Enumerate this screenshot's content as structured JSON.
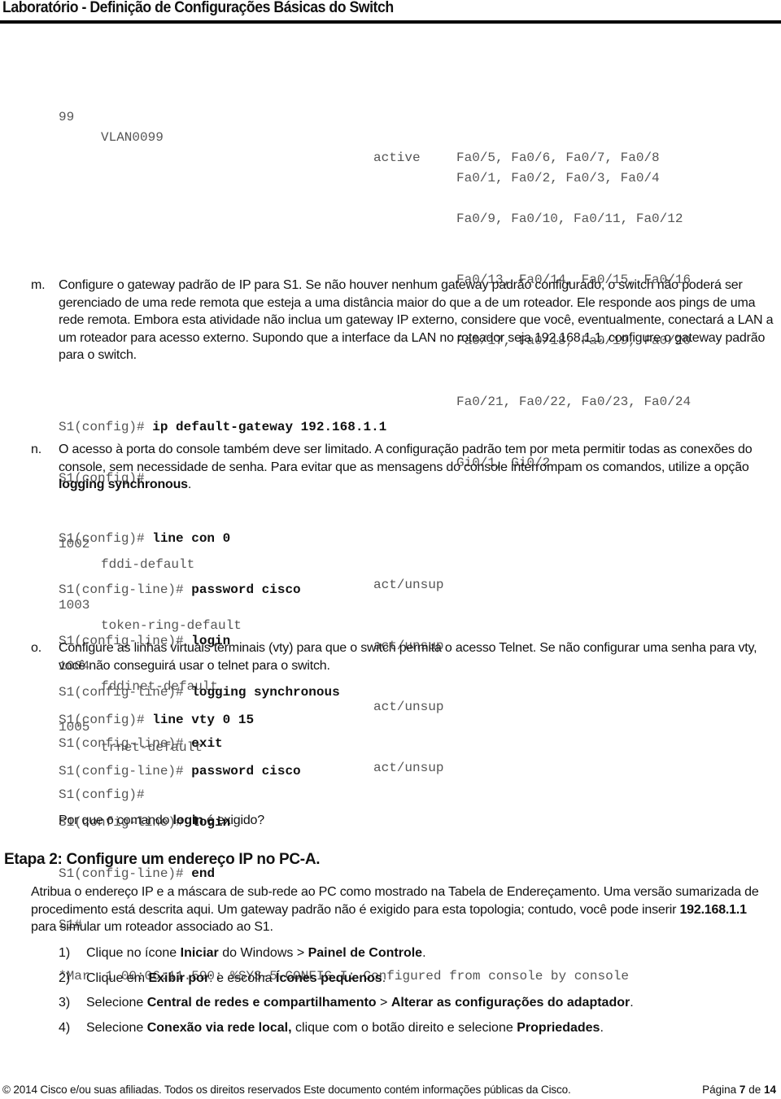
{
  "header": {
    "title": "Laboratório - Definição de Configurações Básicas do Switch"
  },
  "vlan_output": {
    "rows": [
      {
        "id": "99",
        "name": "VLAN0099",
        "status": "active",
        "ports": [
          "Fa0/1, Fa0/2, Fa0/3, Fa0/4",
          "Fa0/5, Fa0/6, Fa0/7, Fa0/8",
          "Fa0/9, Fa0/10, Fa0/11, Fa0/12",
          "Fa0/13, Fa0/14, Fa0/15, Fa0/16",
          "Fa0/17, Fa0/18, Fa0/19, Fa0/20",
          "Fa0/21, Fa0/22, Fa0/23, Fa0/24",
          "Gi0/1, Gi0/2"
        ]
      },
      {
        "id": "1002",
        "name": "fddi-default",
        "status": "act/unsup"
      },
      {
        "id": "1003",
        "name": "token-ring-default",
        "status": "act/unsup"
      },
      {
        "id": "1004",
        "name": "fddinet-default",
        "status": "act/unsup"
      },
      {
        "id": "1005",
        "name": "trnet-default",
        "status": "act/unsup"
      }
    ]
  },
  "step_m": {
    "marker": "m.",
    "text": "Configure o gateway padrão de IP para S1. Se não houver nenhum gateway padrão configurado, o switch não poderá ser gerenciado de uma rede remota que esteja a uma distância maior do que a de um roteador. Ele responde aos pings de uma rede remota. Embora esta atividade não inclua um gateway IP externo, considere que você, eventualmente, conectará a LAN a um roteador para acesso externo. Supondo que a interface da LAN no roteador seja 192.168.1.1, configure o gateway padrão para o switch.",
    "commands": [
      {
        "prompt": "S1(config)# ",
        "cmd": "ip default-gateway 192.168.1.1"
      },
      {
        "prompt": "S1(config)#",
        "cmd": ""
      }
    ]
  },
  "step_n": {
    "marker": "n.",
    "text_before": "O acesso à porta do console também deve ser limitado. A configuração padrão tem por meta permitir todas as conexões do console, sem necessidade de senha. Para evitar que as mensagens do console interrompam os comandos, utilize a opção ",
    "text_bold": "logging synchronous",
    "text_after": ".",
    "commands": [
      {
        "prompt": "S1(config)# ",
        "cmd": "line con 0"
      },
      {
        "prompt": "S1(config-line)# ",
        "cmd": "password cisco"
      },
      {
        "prompt": "S1(config-line)# ",
        "cmd": "login"
      },
      {
        "prompt": "S1(config-line)# ",
        "cmd": "logging synchronous"
      },
      {
        "prompt": "S1(config-line)# ",
        "cmd": "exit"
      },
      {
        "prompt": "S1(config)#",
        "cmd": ""
      }
    ]
  },
  "step_o": {
    "marker": "o.",
    "text": "Configure as linhas virtuais terminais (vty) para que o switch permita o acesso Telnet. Se não configurar uma senha para vty, você não conseguirá usar o telnet para o switch.",
    "commands": [
      {
        "prompt": "S1(config)# ",
        "cmd": "line vty 0 15"
      },
      {
        "prompt": "S1(config-line)# ",
        "cmd": "password cisco"
      },
      {
        "prompt": "S1(config-line)# ",
        "cmd": "login"
      },
      {
        "prompt": "S1(config-line)# ",
        "cmd": "end"
      },
      {
        "prompt": "S1#",
        "cmd": ""
      }
    ],
    "log_message": "*Mar  1 00:06:11.590: %SYS-5-CONFIG_I: Configured from console by console",
    "question_before": "Por que o comando ",
    "question_bold": "login",
    "question_after": " é exigido?"
  },
  "etapa2": {
    "title": "Etapa 2: Configure um endereço IP no PC-A.",
    "intro_before": "Atribua o endereço IP e a máscara de sub-rede ao PC como mostrado na Tabela de Endereçamento. Uma versão sumarizada de procedimento está descrita aqui. Um gateway padrão não é exigido para esta topologia; contudo, você pode inserir ",
    "intro_bold": "192.168.1.1",
    "intro_after": " para simular um roteador associado ao S1.",
    "steps": [
      {
        "num": "1)",
        "parts": [
          {
            "t": "Clique no ícone ",
            "b": false
          },
          {
            "t": "Iniciar",
            "b": true
          },
          {
            "t": " do Windows > ",
            "b": false
          },
          {
            "t": "Painel de Controle",
            "b": true
          },
          {
            "t": ".",
            "b": false
          }
        ]
      },
      {
        "num": "2)",
        "parts": [
          {
            "t": "Clique em ",
            "b": false
          },
          {
            "t": "Exibir por",
            "b": true
          },
          {
            "t": ": e escolha ",
            "b": false
          },
          {
            "t": "Ícones pequenos",
            "b": true
          },
          {
            "t": ".",
            "b": false
          }
        ]
      },
      {
        "num": "3)",
        "parts": [
          {
            "t": "Selecione ",
            "b": false
          },
          {
            "t": "Central de redes e compartilhamento",
            "b": true
          },
          {
            "t": " > ",
            "b": false
          },
          {
            "t": "Alterar as configurações do adaptador",
            "b": true
          },
          {
            "t": ".",
            "b": false
          }
        ]
      },
      {
        "num": "4)",
        "parts": [
          {
            "t": "Selecione ",
            "b": false
          },
          {
            "t": "Conexão via rede local,",
            "b": true
          },
          {
            "t": " clique com o botão direito e selecione ",
            "b": false
          },
          {
            "t": "Propriedades",
            "b": true
          },
          {
            "t": ".",
            "b": false
          }
        ]
      }
    ]
  },
  "footer": {
    "copyright": "© 2014 Cisco e/ou suas afiliadas. Todos os direitos reservados Este documento contém informações públicas da Cisco.",
    "page_label": "Página ",
    "page_current": "7",
    "page_of": " de ",
    "page_total": "14"
  }
}
